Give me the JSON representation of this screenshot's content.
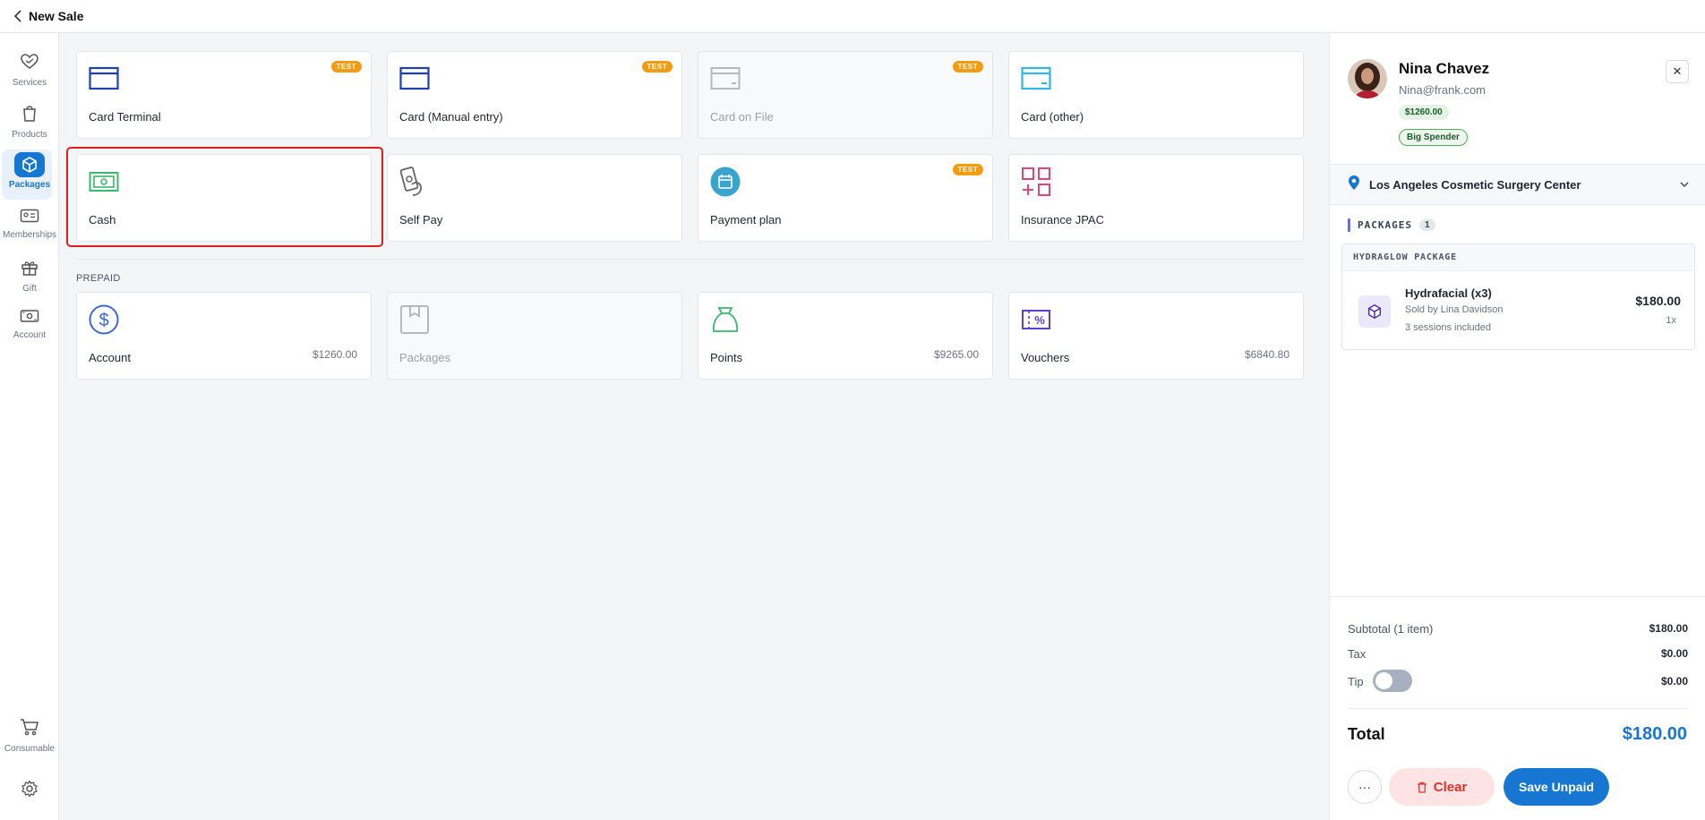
{
  "header": {
    "title": "New Sale"
  },
  "sidebar": {
    "items": [
      {
        "label": "Services",
        "icon": "heart-hand-icon"
      },
      {
        "label": "Products",
        "icon": "bag-icon"
      },
      {
        "label": "Packages",
        "icon": "box-icon",
        "active": true
      },
      {
        "label": "Memberships",
        "icon": "card-id-icon"
      },
      {
        "label": "Gift",
        "icon": "gift-icon"
      },
      {
        "label": "Account",
        "icon": "cash-icon"
      },
      {
        "label": "Consumable",
        "icon": "cart-icon"
      }
    ],
    "settings_icon": "gear-icon"
  },
  "payment_methods": [
    {
      "label": "Card Terminal",
      "icon": "credit-card-icon",
      "badge": "TEST"
    },
    {
      "label": "Card (Manual entry)",
      "icon": "credit-card-icon",
      "badge": "TEST"
    },
    {
      "label": "Card on File",
      "icon": "credit-card-icon",
      "badge": "TEST",
      "disabled": true
    },
    {
      "label": "Card (other)",
      "icon": "credit-card-icon"
    },
    {
      "label": "Cash",
      "icon": "banknote-icon",
      "selected": true
    },
    {
      "label": "Self Pay",
      "icon": "hand-card-icon"
    },
    {
      "label": "Payment plan",
      "icon": "calendar-icon",
      "badge": "TEST"
    },
    {
      "label": "Insurance JPAC",
      "icon": "grid-plus-icon"
    }
  ],
  "prepaid": {
    "heading": "PREPAID",
    "items": [
      {
        "label": "Account",
        "amount": "$1260.00",
        "icon": "dollar-circle-icon"
      },
      {
        "label": "Packages",
        "amount": "",
        "icon": "package-icon",
        "disabled": true
      },
      {
        "label": "Points",
        "amount": "$9265.00",
        "icon": "money-bag-icon"
      },
      {
        "label": "Vouchers",
        "amount": "$6840.80",
        "icon": "voucher-icon"
      }
    ]
  },
  "customer": {
    "name": "Nina Chavez",
    "email": "Nina@frank.com",
    "balance": "$1260.00",
    "tag": "Big Spender"
  },
  "location": {
    "name": "Los Angeles Cosmetic Surgery Center"
  },
  "cart": {
    "section_label": "PACKAGES",
    "count": "1",
    "package_name": "HYDRAGLOW PACKAGE",
    "item": {
      "name": "Hydrafacial (x3)",
      "sold_by": "Sold by Lina Davidson",
      "sessions": "3 sessions included",
      "price": "$180.00",
      "qty": "1x"
    }
  },
  "summary": {
    "subtotal_label": "Subtotal (1 item)",
    "subtotal": "$180.00",
    "tax_label": "Tax",
    "tax": "$0.00",
    "tip_label": "Tip",
    "tip": "$0.00",
    "tip_enabled": false,
    "total_label": "Total",
    "total": "$180.00"
  },
  "actions": {
    "more": "···",
    "clear": "Clear",
    "save": "Save Unpaid"
  },
  "colors": {
    "primary": "#1776d2",
    "test_badge": "#f39c12",
    "highlight": "#e11d1d",
    "danger": "#e03131"
  }
}
